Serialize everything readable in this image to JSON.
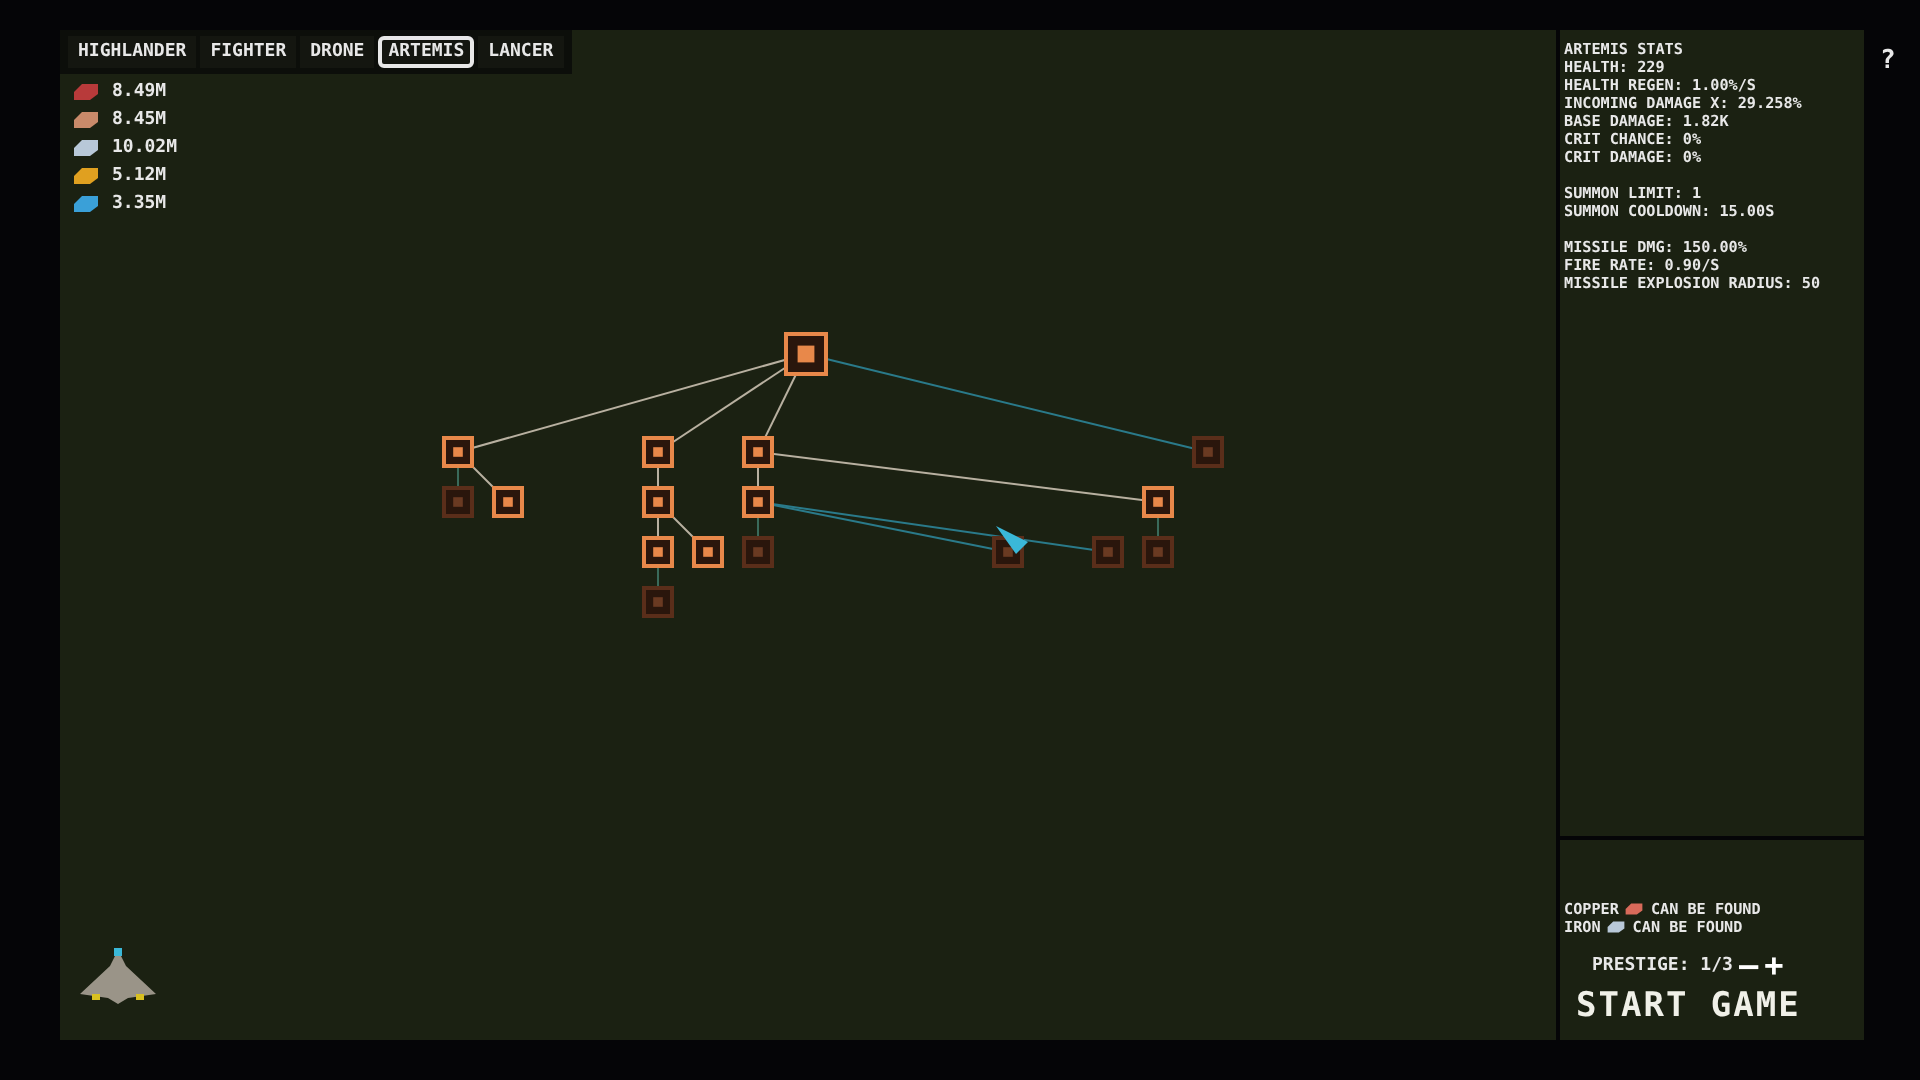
{
  "tabs": [
    {
      "label": "HIGHLANDER",
      "selected": false
    },
    {
      "label": "FIGHTER",
      "selected": false
    },
    {
      "label": "DRONE",
      "selected": false
    },
    {
      "label": "ARTEMIS",
      "selected": true
    },
    {
      "label": "LANCER",
      "selected": false
    }
  ],
  "resources": [
    {
      "amount": "8.49M",
      "color": "#b83a3a"
    },
    {
      "amount": "8.45M",
      "color": "#c98a6a"
    },
    {
      "amount": "10.02M",
      "color": "#b8c8d8"
    },
    {
      "amount": "5.12M",
      "color": "#e0a020"
    },
    {
      "amount": "3.35M",
      "color": "#3aa0d8"
    }
  ],
  "skill_nodes": [
    {
      "unlocked": true
    },
    {
      "unlocked": true
    },
    {
      "unlocked": true
    },
    {
      "unlocked": true
    },
    {
      "unlocked": false
    },
    {
      "unlocked": false
    },
    {
      "unlocked": true
    },
    {
      "unlocked": true
    },
    {
      "unlocked": true
    },
    {
      "unlocked": true
    },
    {
      "unlocked": true
    },
    {
      "unlocked": true
    },
    {
      "unlocked": false
    },
    {
      "unlocked": false
    },
    {
      "unlocked": false
    },
    {
      "unlocked": false
    },
    {
      "unlocked": false
    }
  ],
  "stats": {
    "title": "ARTEMIS STATS",
    "groups": [
      [
        "HEALTH: 229",
        "HEALTH REGEN: 1.00%/S",
        "INCOMING DAMAGE X: 29.258%",
        "BASE DAMAGE: 1.82K",
        "CRIT CHANCE: 0%",
        "CRIT DAMAGE: 0%"
      ],
      [
        "SUMMON LIMIT: 1",
        "SUMMON COOLDOWN: 15.00S"
      ],
      [
        "MISSILE DMG: 150.00%",
        "FIRE RATE: 0.90/S",
        "MISSILE EXPLOSION RADIUS: 50"
      ]
    ]
  },
  "findings": [
    {
      "before": "COPPER",
      "after": "CAN BE FOUND",
      "color": "#d86a5a"
    },
    {
      "before": "IRON",
      "after": "CAN BE FOUND",
      "color": "#b8c8d8"
    }
  ],
  "prestige": {
    "label": "PRESTIGE: 1/3",
    "minus": "—",
    "plus": "+"
  },
  "start_button": "START GAME",
  "help": "?"
}
